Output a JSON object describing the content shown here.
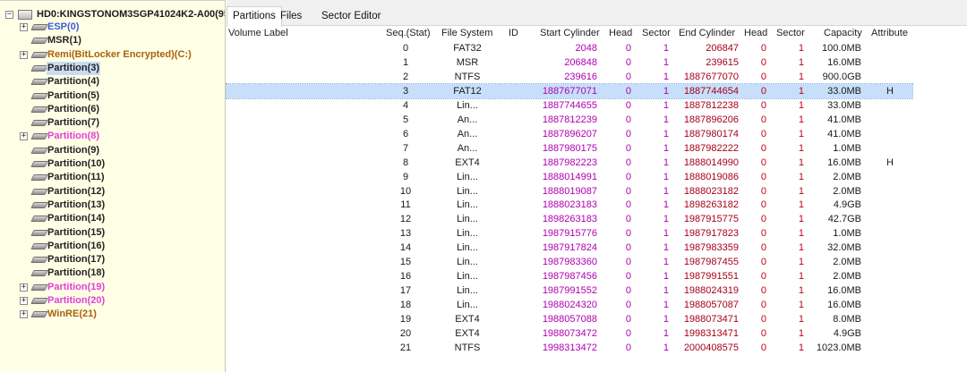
{
  "colors": {
    "tree_background": "#ffffe6",
    "selection": "#c7dffa",
    "normal_partition": "#222222",
    "esp_partition": "#3b5bd8",
    "linux_partition": "#e040d8",
    "windows_partition": "#a8620a",
    "start_values": "#b000b0",
    "end_values": "#a8001a"
  },
  "tree": {
    "disk": {
      "label": "HD0:KINGSTONOM3SGP41024K2-A00(95",
      "expander": "−"
    },
    "items": [
      {
        "label": "ESP(0)",
        "color": "#3b5bd8",
        "expander": "+"
      },
      {
        "label": "MSR(1)",
        "color": "#222222",
        "expander": ""
      },
      {
        "label": "Remi(BitLocker Encrypted)(C:)",
        "color": "#a8620a",
        "expander": "+"
      },
      {
        "label": "Partition(3)",
        "color": "#222222",
        "expander": "",
        "selected": true
      },
      {
        "label": "Partition(4)",
        "color": "#222222",
        "expander": ""
      },
      {
        "label": "Partition(5)",
        "color": "#222222",
        "expander": ""
      },
      {
        "label": "Partition(6)",
        "color": "#222222",
        "expander": ""
      },
      {
        "label": "Partition(7)",
        "color": "#222222",
        "expander": ""
      },
      {
        "label": "Partition(8)",
        "color": "#e040d8",
        "expander": "+"
      },
      {
        "label": "Partition(9)",
        "color": "#222222",
        "expander": ""
      },
      {
        "label": "Partition(10)",
        "color": "#222222",
        "expander": ""
      },
      {
        "label": "Partition(11)",
        "color": "#222222",
        "expander": ""
      },
      {
        "label": "Partition(12)",
        "color": "#222222",
        "expander": ""
      },
      {
        "label": "Partition(13)",
        "color": "#222222",
        "expander": ""
      },
      {
        "label": "Partition(14)",
        "color": "#222222",
        "expander": ""
      },
      {
        "label": "Partition(15)",
        "color": "#222222",
        "expander": ""
      },
      {
        "label": "Partition(16)",
        "color": "#222222",
        "expander": ""
      },
      {
        "label": "Partition(17)",
        "color": "#222222",
        "expander": ""
      },
      {
        "label": "Partition(18)",
        "color": "#222222",
        "expander": ""
      },
      {
        "label": "Partition(19)",
        "color": "#e040d8",
        "expander": "+"
      },
      {
        "label": "Partition(20)",
        "color": "#e040d8",
        "expander": "+"
      },
      {
        "label": "WinRE(21)",
        "color": "#a8620a",
        "expander": "+"
      }
    ]
  },
  "tabs": [
    {
      "label": "Partitions",
      "active": true
    },
    {
      "label": "Files",
      "active": false
    },
    {
      "label": "Sector Editor",
      "active": false
    }
  ],
  "columns": {
    "volume_label": "Volume Label",
    "seq": "Seq.(Stat)",
    "file_system": "File System",
    "id": "ID",
    "start_cylinder": "Start Cylinder",
    "head": "Head",
    "sector": "Sector",
    "end_cylinder": "End Cylinder",
    "end_head": "Head",
    "end_sector": "Sector",
    "capacity": "Capacity",
    "attribute": "Attribute"
  },
  "rows": [
    {
      "label": "ESP(0)",
      "color": "#3b5bd8",
      "seq": "0",
      "fs": "FAT32",
      "id": "",
      "start_cyl": "2048",
      "head": "0",
      "sector": "1",
      "end_cyl": "206847",
      "end_head": "0",
      "end_sector": "1",
      "capacity": "100.0MB",
      "attr": ""
    },
    {
      "label": "MSR(1)",
      "color": "#222222",
      "seq": "1",
      "fs": "MSR",
      "id": "",
      "start_cyl": "206848",
      "head": "0",
      "sector": "1",
      "end_cyl": "239615",
      "end_head": "0",
      "end_sector": "1",
      "capacity": "16.0MB",
      "attr": ""
    },
    {
      "label": "Remi(BitLocker ...",
      "color": "#a8620a",
      "seq": "2",
      "fs": "NTFS",
      "id": "",
      "start_cyl": "239616",
      "head": "0",
      "sector": "1",
      "end_cyl": "1887677070",
      "end_head": "0",
      "end_sector": "1",
      "capacity": "900.0GB",
      "attr": ""
    },
    {
      "label": "Partition(3)",
      "color": "#222222",
      "seq": "3",
      "fs": "FAT12",
      "id": "",
      "start_cyl": "1887677071",
      "head": "0",
      "sector": "1",
      "end_cyl": "1887744654",
      "end_head": "0",
      "end_sector": "1",
      "capacity": "33.0MB",
      "attr": "H",
      "selected": true
    },
    {
      "label": "Partition(4)",
      "color": "#222222",
      "seq": "4",
      "fs": "Lin...",
      "id": "",
      "start_cyl": "1887744655",
      "head": "0",
      "sector": "1",
      "end_cyl": "1887812238",
      "end_head": "0",
      "end_sector": "1",
      "capacity": "33.0MB",
      "attr": ""
    },
    {
      "label": "Partition(5)",
      "color": "#222222",
      "seq": "5",
      "fs": "An...",
      "id": "",
      "start_cyl": "1887812239",
      "head": "0",
      "sector": "1",
      "end_cyl": "1887896206",
      "end_head": "0",
      "end_sector": "1",
      "capacity": "41.0MB",
      "attr": ""
    },
    {
      "label": "Partition(6)",
      "color": "#222222",
      "seq": "6",
      "fs": "An...",
      "id": "",
      "start_cyl": "1887896207",
      "head": "0",
      "sector": "1",
      "end_cyl": "1887980174",
      "end_head": "0",
      "end_sector": "1",
      "capacity": "41.0MB",
      "attr": ""
    },
    {
      "label": "Partition(7)",
      "color": "#222222",
      "seq": "7",
      "fs": "An...",
      "id": "",
      "start_cyl": "1887980175",
      "head": "0",
      "sector": "1",
      "end_cyl": "1887982222",
      "end_head": "0",
      "end_sector": "1",
      "capacity": "1.0MB",
      "attr": ""
    },
    {
      "label": "Partition(8)",
      "color": "#e040d8",
      "seq": "8",
      "fs": "EXT4",
      "id": "",
      "start_cyl": "1887982223",
      "head": "0",
      "sector": "1",
      "end_cyl": "1888014990",
      "end_head": "0",
      "end_sector": "1",
      "capacity": "16.0MB",
      "attr": "H"
    },
    {
      "label": "Partition(9)",
      "color": "#222222",
      "seq": "9",
      "fs": "Lin...",
      "id": "",
      "start_cyl": "1888014991",
      "head": "0",
      "sector": "1",
      "end_cyl": "1888019086",
      "end_head": "0",
      "end_sector": "1",
      "capacity": "2.0MB",
      "attr": ""
    },
    {
      "label": "Partition(10)",
      "color": "#222222",
      "seq": "10",
      "fs": "Lin...",
      "id": "",
      "start_cyl": "1888019087",
      "head": "0",
      "sector": "1",
      "end_cyl": "1888023182",
      "end_head": "0",
      "end_sector": "1",
      "capacity": "2.0MB",
      "attr": ""
    },
    {
      "label": "Partition(11)",
      "color": "#222222",
      "seq": "11",
      "fs": "Lin...",
      "id": "",
      "start_cyl": "1888023183",
      "head": "0",
      "sector": "1",
      "end_cyl": "1898263182",
      "end_head": "0",
      "end_sector": "1",
      "capacity": "4.9GB",
      "attr": ""
    },
    {
      "label": "Partition(12)",
      "color": "#222222",
      "seq": "12",
      "fs": "Lin...",
      "id": "",
      "start_cyl": "1898263183",
      "head": "0",
      "sector": "1",
      "end_cyl": "1987915775",
      "end_head": "0",
      "end_sector": "1",
      "capacity": "42.7GB",
      "attr": ""
    },
    {
      "label": "Partition(13)",
      "color": "#222222",
      "seq": "13",
      "fs": "Lin...",
      "id": "",
      "start_cyl": "1987915776",
      "head": "0",
      "sector": "1",
      "end_cyl": "1987917823",
      "end_head": "0",
      "end_sector": "1",
      "capacity": "1.0MB",
      "attr": ""
    },
    {
      "label": "Partition(14)",
      "color": "#222222",
      "seq": "14",
      "fs": "Lin...",
      "id": "",
      "start_cyl": "1987917824",
      "head": "0",
      "sector": "1",
      "end_cyl": "1987983359",
      "end_head": "0",
      "end_sector": "1",
      "capacity": "32.0MB",
      "attr": ""
    },
    {
      "label": "Partition(15)",
      "color": "#222222",
      "seq": "15",
      "fs": "Lin...",
      "id": "",
      "start_cyl": "1987983360",
      "head": "0",
      "sector": "1",
      "end_cyl": "1987987455",
      "end_head": "0",
      "end_sector": "1",
      "capacity": "2.0MB",
      "attr": ""
    },
    {
      "label": "Partition(16)",
      "color": "#222222",
      "seq": "16",
      "fs": "Lin...",
      "id": "",
      "start_cyl": "1987987456",
      "head": "0",
      "sector": "1",
      "end_cyl": "1987991551",
      "end_head": "0",
      "end_sector": "1",
      "capacity": "2.0MB",
      "attr": ""
    },
    {
      "label": "Partition(17)",
      "color": "#222222",
      "seq": "17",
      "fs": "Lin...",
      "id": "",
      "start_cyl": "1987991552",
      "head": "0",
      "sector": "1",
      "end_cyl": "1988024319",
      "end_head": "0",
      "end_sector": "1",
      "capacity": "16.0MB",
      "attr": ""
    },
    {
      "label": "Partition(18)",
      "color": "#222222",
      "seq": "18",
      "fs": "Lin...",
      "id": "",
      "start_cyl": "1988024320",
      "head": "0",
      "sector": "1",
      "end_cyl": "1988057087",
      "end_head": "0",
      "end_sector": "1",
      "capacity": "16.0MB",
      "attr": ""
    },
    {
      "label": "Partition(19)",
      "color": "#e040d8",
      "seq": "19",
      "fs": "EXT4",
      "id": "",
      "start_cyl": "1988057088",
      "head": "0",
      "sector": "1",
      "end_cyl": "1988073471",
      "end_head": "0",
      "end_sector": "1",
      "capacity": "8.0MB",
      "attr": ""
    },
    {
      "label": "Partition(20)",
      "color": "#e040d8",
      "seq": "20",
      "fs": "EXT4",
      "id": "",
      "start_cyl": "1988073472",
      "head": "0",
      "sector": "1",
      "end_cyl": "1998313471",
      "end_head": "0",
      "end_sector": "1",
      "capacity": "4.9GB",
      "attr": ""
    },
    {
      "label": "WinRE(21)",
      "color": "#a8620a",
      "seq": "21",
      "fs": "NTFS",
      "id": "",
      "start_cyl": "1998313472",
      "head": "0",
      "sector": "1",
      "end_cyl": "2000408575",
      "end_head": "0",
      "end_sector": "1",
      "capacity": "1023.0MB",
      "attr": ""
    }
  ]
}
